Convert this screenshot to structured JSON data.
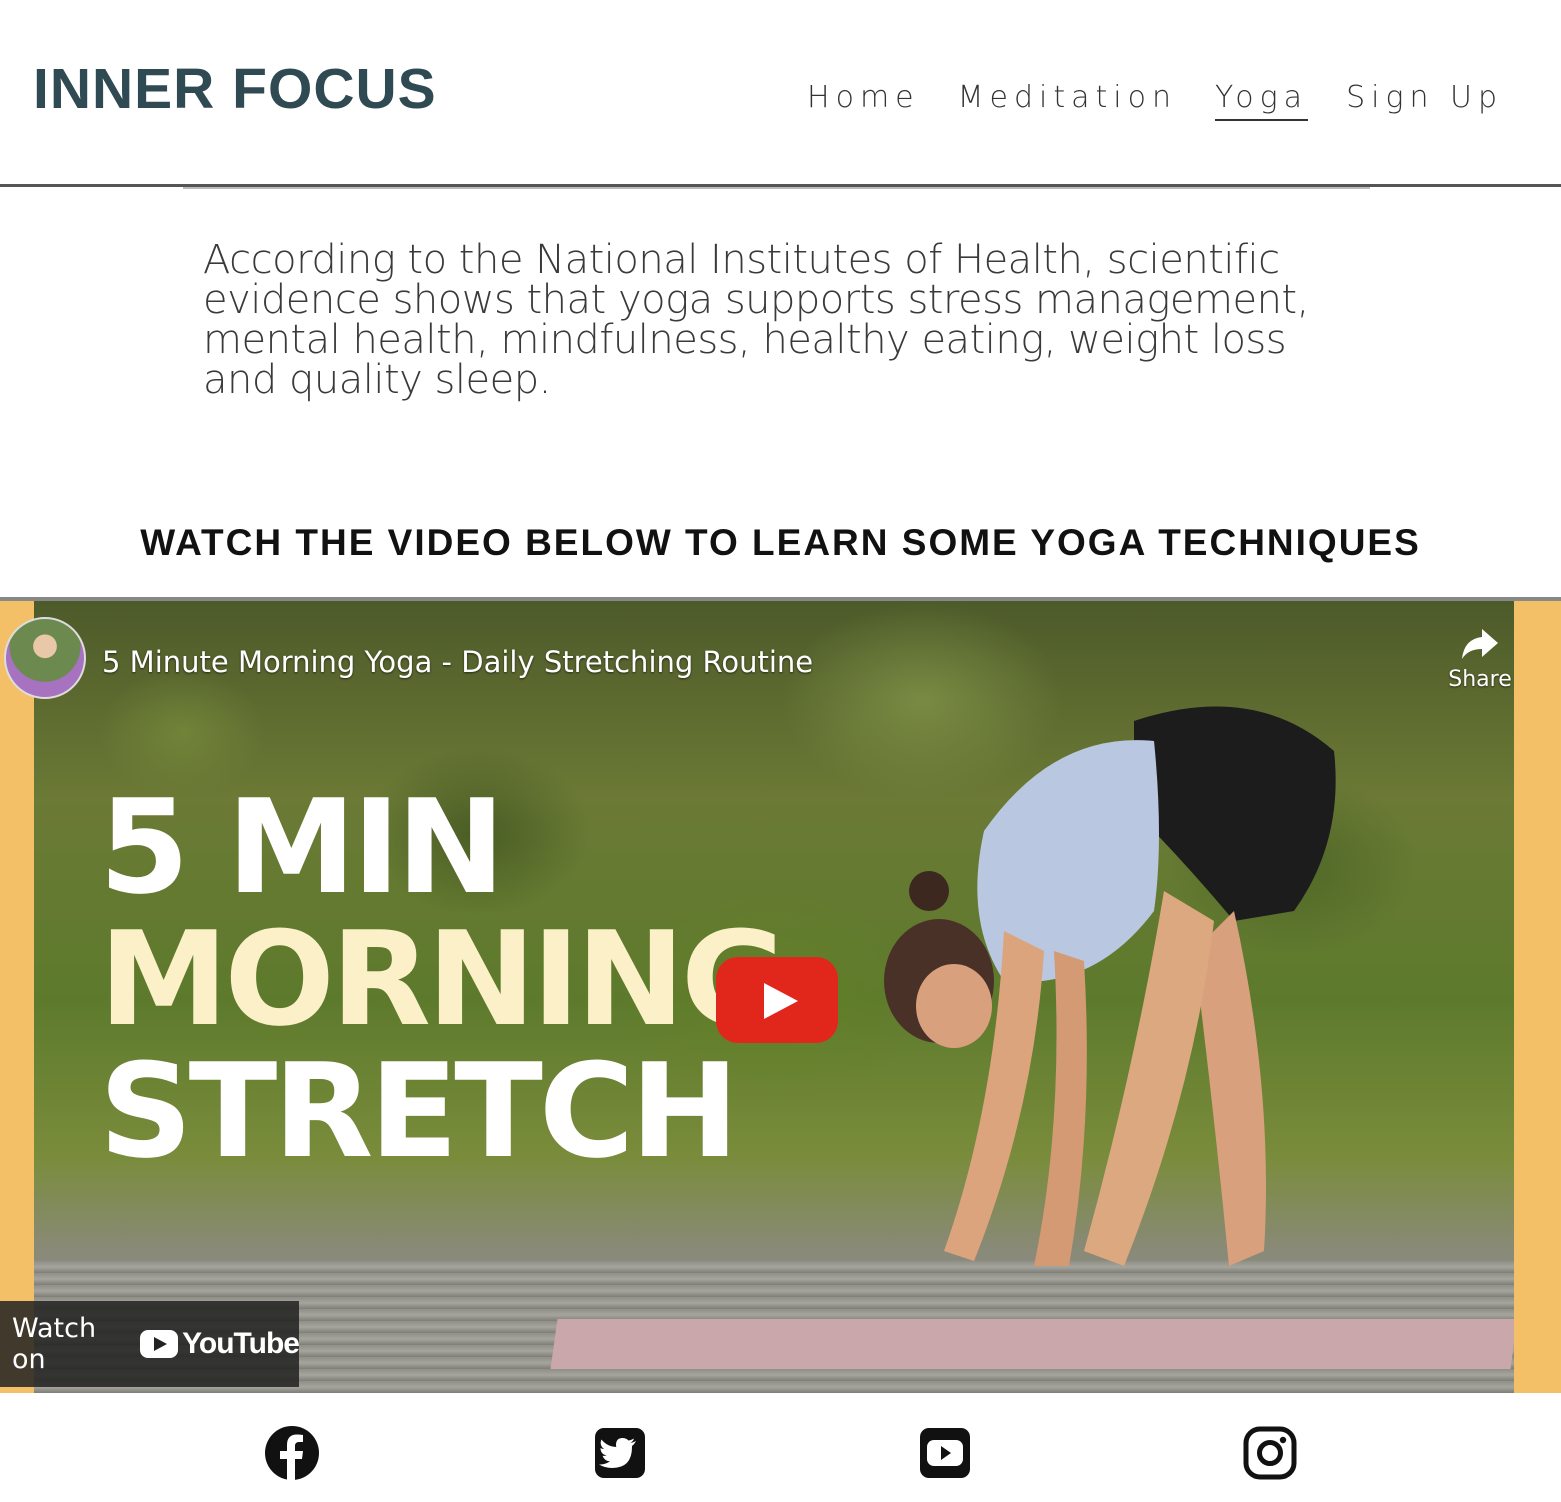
{
  "header": {
    "brand": "INNER FOCUS",
    "nav": [
      {
        "label": "Home",
        "active": false
      },
      {
        "label": "Meditation",
        "active": false
      },
      {
        "label": "Yoga",
        "active": true
      },
      {
        "label": "Sign Up",
        "active": false
      }
    ]
  },
  "intro": {
    "text": "According to the National Institutes of Health, scientific evidence shows that yoga supports stress management, mental health, mindfulness, healthy eating, weight loss and quality sleep."
  },
  "video_section": {
    "heading": "WATCH THE VIDEO BELOW TO LEARN SOME YOGA TECHNIQUES",
    "video": {
      "title": "5 Minute Morning Yoga - Daily Stretching Routine",
      "share_label": "Share",
      "thumbnail_text": [
        "5 MIN",
        "MORNING",
        "STRETCH"
      ],
      "watch_on_label": "Watch on",
      "youtube_label": "YouTube",
      "play_color": "#e1261c"
    }
  },
  "footer": {
    "social_icons": [
      "facebook-icon",
      "twitter-icon",
      "youtube-icon",
      "instagram-icon"
    ]
  },
  "colors": {
    "brand": "#2f4a52",
    "video_side_band": "#f3c068"
  }
}
